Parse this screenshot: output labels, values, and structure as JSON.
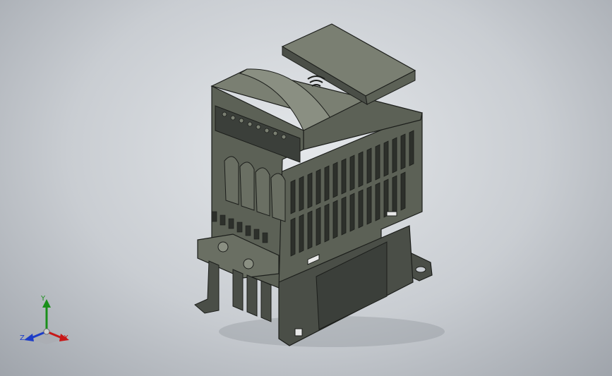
{
  "colors": {
    "body_dark": "#3b3f3a",
    "body_mid": "#5c6156",
    "body_light": "#7a7f72",
    "axis_x": "#c81818",
    "axis_y": "#1a8f1a",
    "axis_z": "#1c3cc8"
  },
  "triad": {
    "x_label": "X",
    "y_label": "Y",
    "z_label": "Z"
  }
}
